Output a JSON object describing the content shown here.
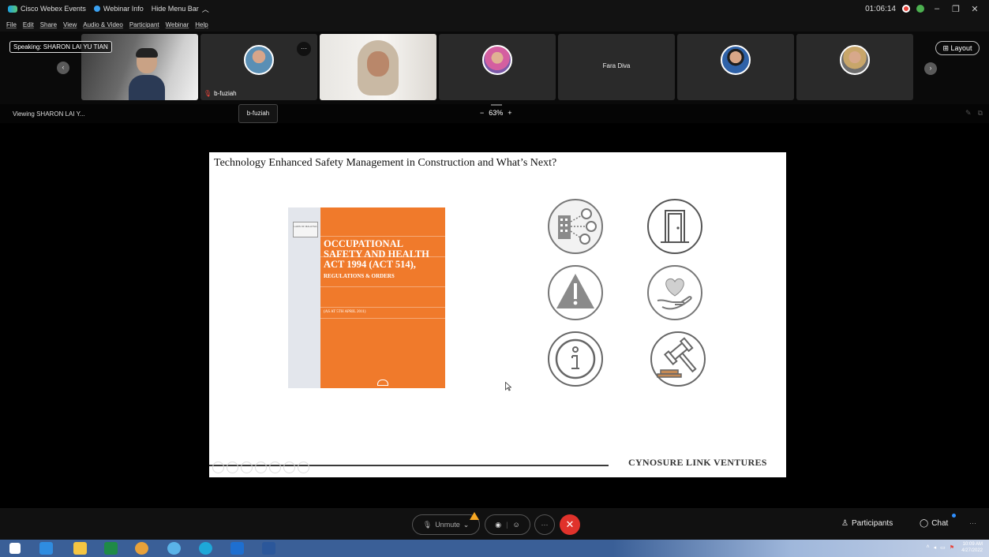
{
  "titlebar": {
    "app_name": "Cisco Webex Events",
    "webinar_info": "Webinar Info",
    "hide_menu": "Hide Menu Bar",
    "timer": "01:06:14"
  },
  "menu": [
    "File",
    "Edit",
    "Share",
    "View",
    "Audio & Video",
    "Participant",
    "Webinar",
    "Help"
  ],
  "video_strip": {
    "speaking_label": "Speaking: SHARON LAI YU TIAN",
    "layout_label": "Layout",
    "tiles": [
      {
        "name": ""
      },
      {
        "name": "b-fuziah"
      },
      {
        "name": ""
      },
      {
        "name": ""
      },
      {
        "name": "Fara Diva"
      },
      {
        "name": ""
      },
      {
        "name": ""
      }
    ]
  },
  "viewbar": {
    "viewing": "Viewing SHARON LAI Y...",
    "tooltip": "b-fuziah",
    "zoom": "63%",
    "zoom_minus": "−",
    "zoom_plus": "+"
  },
  "slide": {
    "title": "Technology Enhanced Safety Management in Construction and What’s Next?",
    "book_label": "LAWS OF MALAYSIA",
    "book_title_lines": [
      "OCCUPATIONAL",
      "SAFETY AND HEALTH",
      "ACT 1994 (ACT 514),"
    ],
    "book_subtitle": "REGULATIONS & ORDERS",
    "book_date": "(AS AT 5TH APRIL 2011)",
    "brand": "CYNOSURE LINK VENTURES",
    "icons": [
      "network-building-icon",
      "door-exit-icon",
      "warning-icon",
      "heart-hand-icon",
      "info-icon",
      "gavel-icon"
    ]
  },
  "controls": {
    "unmute": "Unmute",
    "participants": "Participants",
    "chat": "Chat"
  },
  "taskbar": {
    "time": "10:09 AM",
    "date": "4/27/2022"
  },
  "colors": {
    "accent_red": "#e0322b",
    "book_orange": "#f07a2b",
    "warning": "#f5a623"
  }
}
